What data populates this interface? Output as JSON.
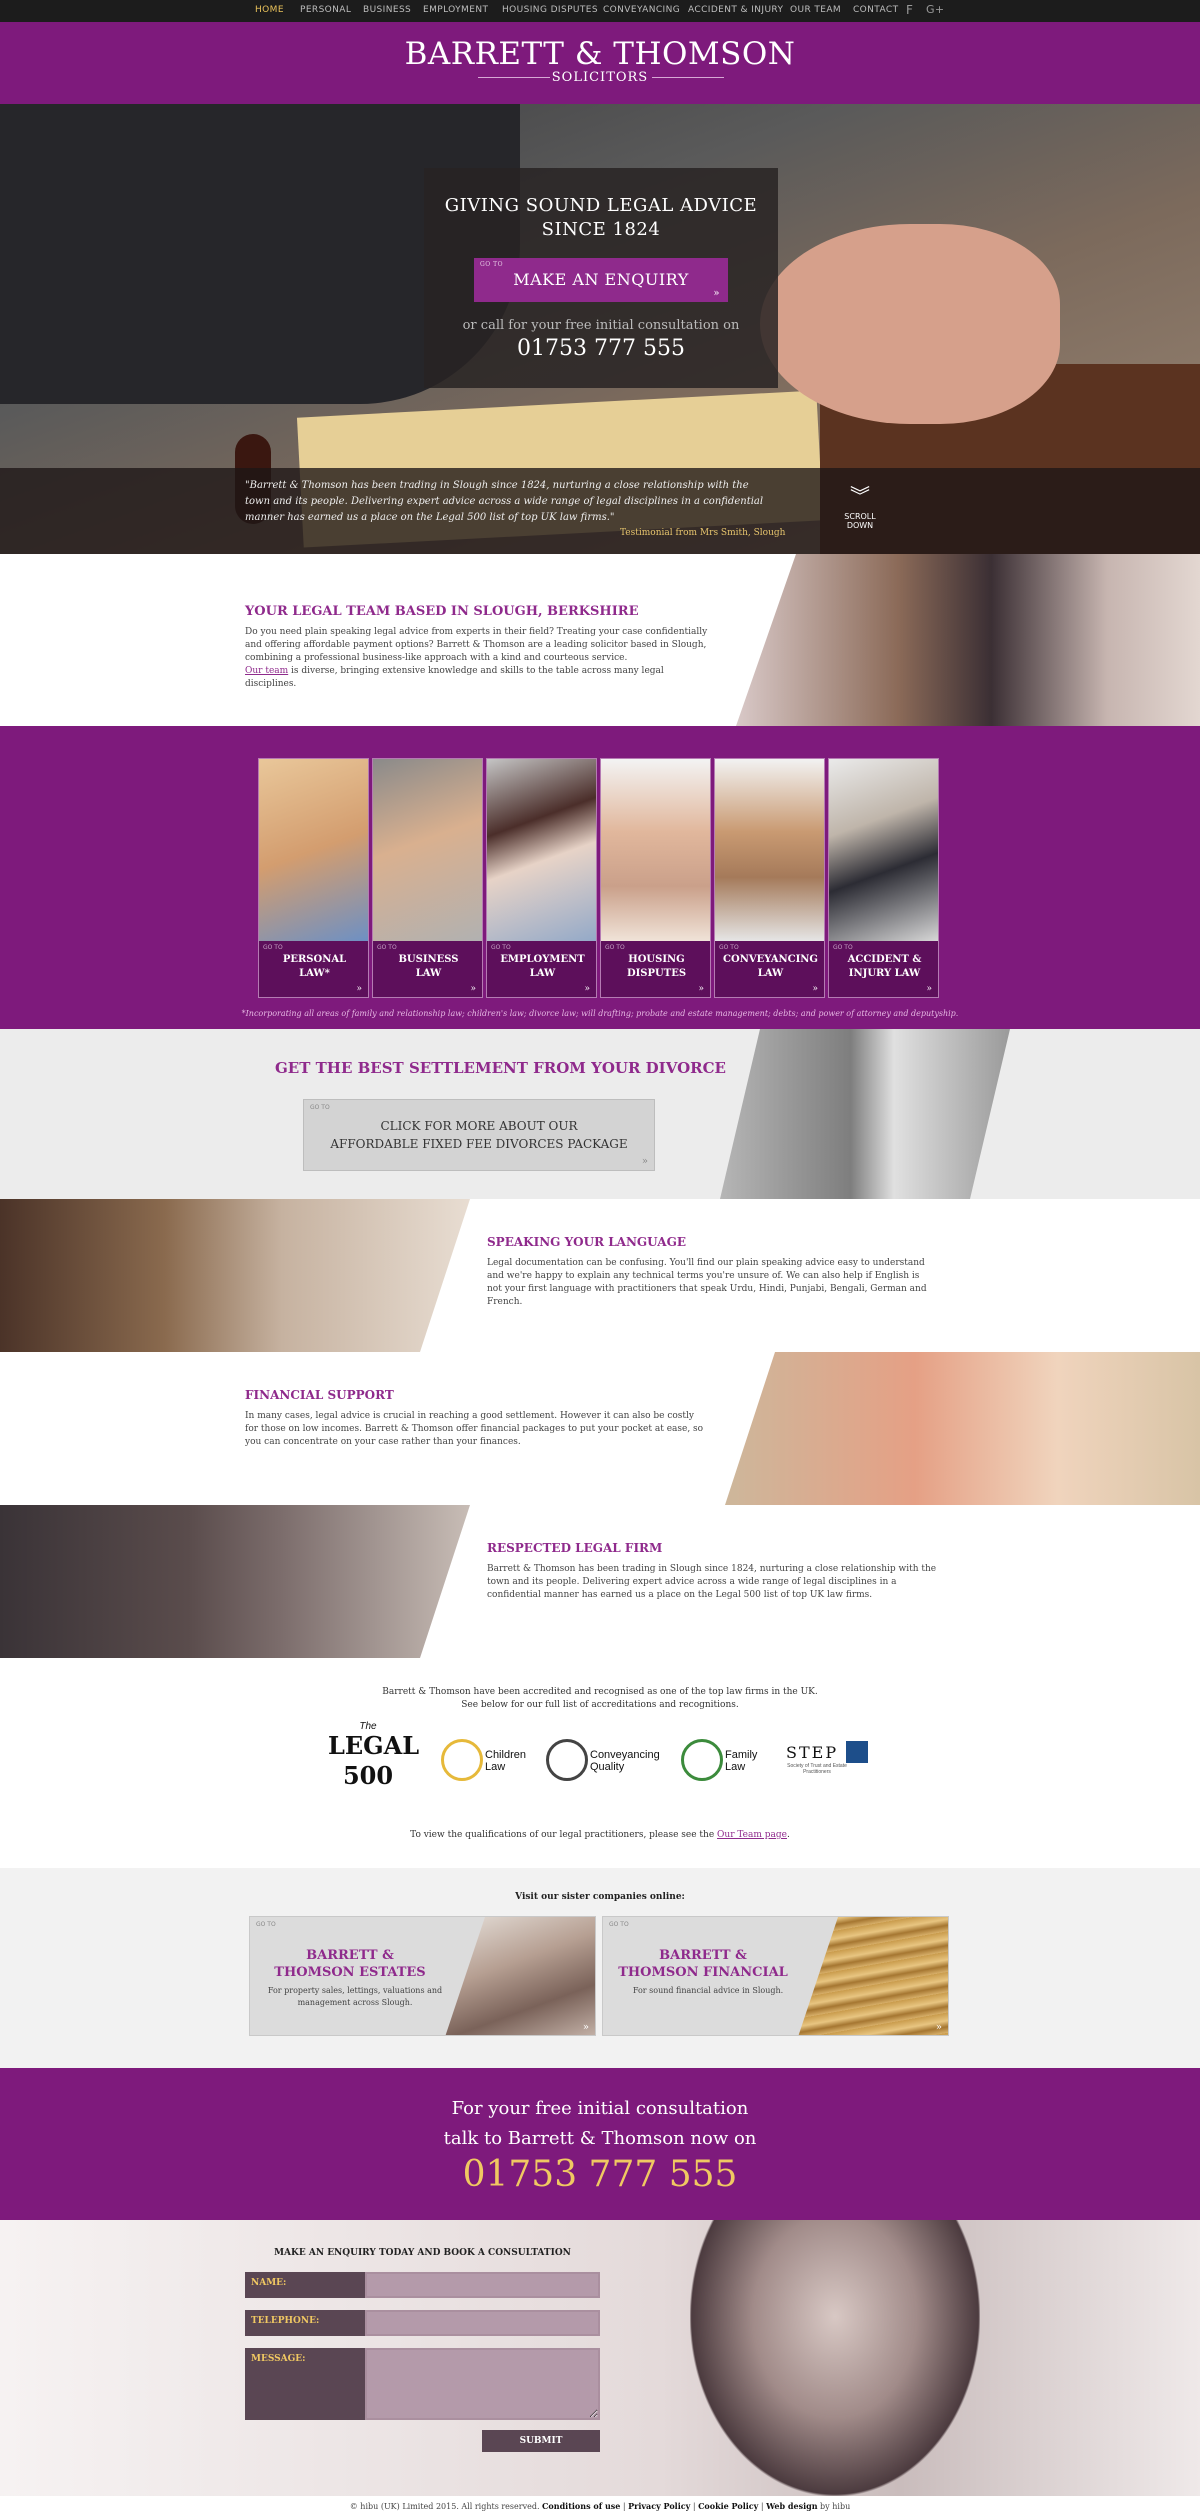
{
  "nav": {
    "items": [
      "HOME",
      "PERSONAL",
      "BUSINESS",
      "EMPLOYMENT",
      "HOUSING DISPUTES",
      "CONVEYANCING",
      "ACCIDENT & INJURY",
      "OUR TEAM",
      "CONTACT"
    ],
    "facebook_icon": "f",
    "gplus_icon": "g+"
  },
  "logo": {
    "line1": "BARRETT & THOMSON",
    "line2": "SOLICITORS"
  },
  "hero": {
    "heading_line1": "GIVING SOUND LEGAL ADVICE",
    "heading_line2": "SINCE 1824",
    "goto": "GO TO",
    "button": "MAKE AN ENQUIRY",
    "call_text": "or call for your free initial consultation on",
    "phone": "01753 777 555",
    "testimonial": "\"Barrett & Thomson has been trading in Slough since 1824, nurturing a close relationship with the town and its people. Delivering expert advice across a wide range of legal disciplines in a confidential manner has earned us a place on the Legal 500 list of top UK law firms.\"",
    "testimonial_credit": "Testimonial from Mrs Smith, Slough",
    "scroll_label": "SCROLL DOWN"
  },
  "team": {
    "title": "YOUR LEGAL TEAM BASED IN SLOUGH, BERKSHIRE",
    "text": "Do you need plain speaking legal advice from experts in their field? Treating your case confidentially and offering affordable payment options? Barrett & Thomson are a leading solicitor based in Slough, combining a professional business-like approach with a kind and courteous service.",
    "link": "Our team",
    "text2": " is diverse, bringing extensive knowledge and skills to the table across many legal disciplines."
  },
  "services": {
    "goto": "GO TO",
    "items": [
      {
        "line1": "PERSONAL",
        "line2": "LAW*"
      },
      {
        "line1": "BUSINESS",
        "line2": "LAW"
      },
      {
        "line1": "EMPLOYMENT",
        "line2": "LAW"
      },
      {
        "line1": "HOUSING",
        "line2": "DISPUTES"
      },
      {
        "line1": "CONVEYANCING",
        "line2": "LAW"
      },
      {
        "line1": "ACCIDENT &",
        "line2": "INJURY LAW"
      }
    ],
    "footnote": "*Incorporating all areas of family and relationship law; children's law; divorce law; will drafting; probate and estate management; debts; and power of attorney and deputyship."
  },
  "divorce": {
    "title": "GET THE BEST SETTLEMENT FROM YOUR DIVORCE",
    "goto": "GO TO",
    "button_line1": "CLICK FOR MORE ABOUT OUR",
    "button_line2": "AFFORDABLE FIXED FEE DIVORCES PACKAGE"
  },
  "language": {
    "title": "SPEAKING YOUR LANGUAGE",
    "text": "Legal documentation can be confusing. You'll find our plain speaking advice easy to understand and we're happy to explain any technical terms you're unsure of. We can also help if English is not your first language with practitioners that speak Urdu, Hindi, Punjabi, Bengali, German and French."
  },
  "finance": {
    "title": "FINANCIAL SUPPORT",
    "text": "In many cases, legal advice is crucial in reaching a good settlement. However it can also be costly for those on low incomes. Barrett & Thomson offer financial packages to put your pocket at ease, so you can concentrate on your case rather than your finances."
  },
  "respected": {
    "title": "RESPECTED LEGAL FIRM",
    "text": "Barrett & Thomson has been trading in Slough since 1824, nurturing a close relationship with the town and its people. Delivering expert advice across a wide range of legal disciplines in a confidential manner has earned us a place on the Legal 500 list of top UK law firms."
  },
  "accreditations": {
    "intro_line1": "Barrett & Thomson have been accredited and recognised as one of the top law firms in the UK.",
    "intro_line2": "See below for our full list of accreditations and recognitions.",
    "legal500_the": "The",
    "legal500_word": "LEGAL",
    "legal500_num": "500",
    "badges": [
      {
        "line1": "Children",
        "line2": "Law"
      },
      {
        "line1": "Conveyancing",
        "line2": "Quality"
      },
      {
        "line1": "Family",
        "line2": "Law"
      }
    ],
    "step": "STEP",
    "step_sub": "Society of Trust and Estate Practitioners",
    "outro": "To view the qualifications of our legal practitioners, please see the ",
    "outro_link": "Our Team page",
    "outro_end": "."
  },
  "sister": {
    "label": "Visit our sister companies online:",
    "goto": "GO TO",
    "estates": {
      "line1": "BARRETT &",
      "line2": "THOMSON ESTATES",
      "desc": "For property sales, lettings, valuations and management across Slough."
    },
    "financial": {
      "line1": "BARRETT &",
      "line2": "THOMSON FINANCIAL",
      "desc": "For sound financial advice in Slough."
    }
  },
  "cta": {
    "line1": "For your free initial consultation",
    "line2": "talk to Barrett & Thomson now on",
    "phone": "01753 777 555"
  },
  "form": {
    "title": "MAKE AN ENQUIRY TODAY AND BOOK A CONSULTATION",
    "name_label": "NAME:",
    "telephone_label": "TELEPHONE:",
    "message_label": "MESSAGE:",
    "submit": "SUBMIT"
  },
  "footer": {
    "copyright": "© hibu (UK) Limited 2015. All rights reserved. ",
    "conditions": "Conditions of use",
    "privacy": "Privacy Policy",
    "cookie": "Cookie Policy",
    "webdesign": "Web design",
    "by": " by hibu"
  },
  "colors": {
    "brand_purple": "#7e1a7c",
    "accent_gold": "#f0c862",
    "dark_nav": "#1c1c1c"
  }
}
